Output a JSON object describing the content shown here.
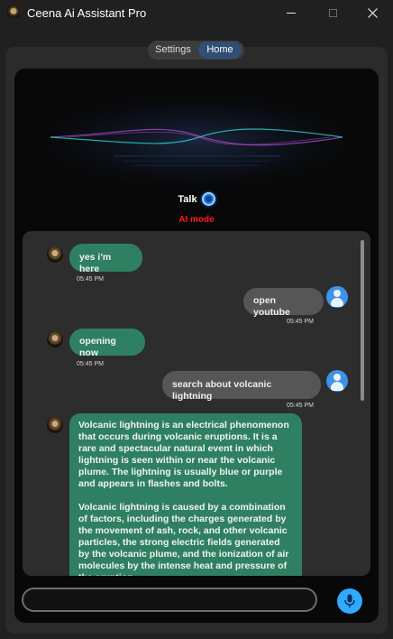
{
  "window": {
    "title": "Ceena Ai Assistant Pro",
    "icons": {
      "app": "app-logo-icon",
      "minimize": "minimize-icon",
      "maximize": "maximize-icon",
      "close": "close-icon"
    }
  },
  "nav": {
    "tabs": [
      {
        "label": "Settings",
        "active": false
      },
      {
        "label": "Home",
        "active": true
      }
    ]
  },
  "assistant": {
    "talk_label": "Talk",
    "mode_label": "AI mode",
    "mode_color": "#ff1a1a"
  },
  "chat": {
    "messages": [
      {
        "sender": "ai",
        "text": "yes i'm here",
        "time": "05:45 PM"
      },
      {
        "sender": "user",
        "text": "open youtube",
        "time": "05:45 PM"
      },
      {
        "sender": "ai",
        "text": "opening now",
        "time": "05:45 PM"
      },
      {
        "sender": "user",
        "text": "search about volcanic lightning",
        "time": "05:45 PM"
      },
      {
        "sender": "ai",
        "text": "Volcanic lightning is an electrical phenomenon that occurs during volcanic eruptions. It is a rare and spectacular natural event in which lightning is seen within or near the volcanic plume. The lightning is usually blue or purple and appears in flashes and bolts.\n\nVolcanic lightning is caused by a combination of factors, including the charges generated by the movement of ash, rock, and other volcanic particles, the strong electric fields generated by the volcanic plume, and the ionization of air molecules by the intense heat and pressure of the eruption."
      }
    ]
  },
  "composer": {
    "input_value": "",
    "mic_icon": "microphone-icon"
  },
  "colors": {
    "ai_bubble": "#2f8062",
    "user_bubble": "#565656",
    "accent": "#2eaaff"
  }
}
